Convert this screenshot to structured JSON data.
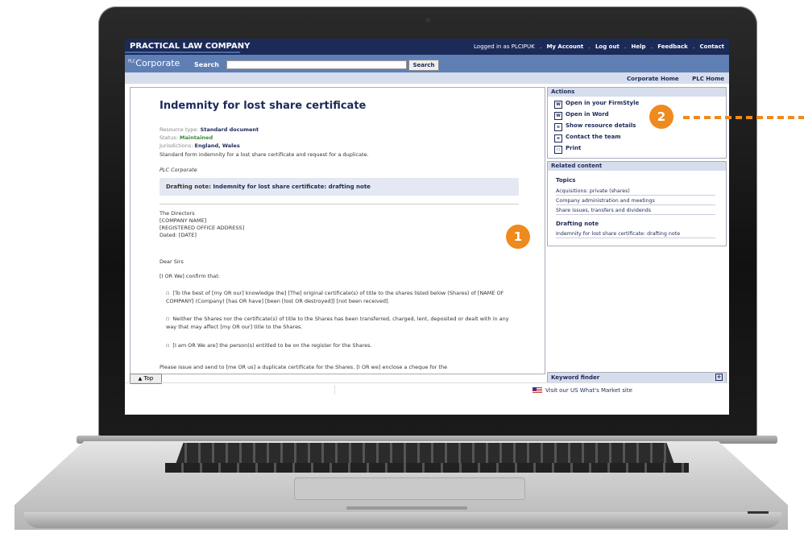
{
  "topbar": {
    "brand": "PRACTICAL LAW COMPANY",
    "logged_in": "Logged in as PLCIPUK",
    "links": [
      ".",
      "My Account",
      ".",
      "Log out",
      ".",
      "Help",
      ".",
      "Feedback",
      ".",
      "Contact"
    ]
  },
  "searchbar": {
    "section_prefix": "PLC",
    "section": "Corporate",
    "search_label": "Search",
    "search_value": "",
    "search_button": "Search"
  },
  "homebar": {
    "links": [
      "Corporate Home",
      "PLC Home"
    ]
  },
  "document": {
    "title": "Indemnity for lost share certificate",
    "resource_type_label": "Resource type:",
    "resource_type": "Standard document",
    "status_label": "Status:",
    "status": "Maintained",
    "jurisdictions_label": "Jurisdictions:",
    "jurisdictions": "England, Wales",
    "summary": "Standard form indemnity for a lost share certificate and request for a duplicate.",
    "source": "PLC Corporate",
    "drafting_label": "Drafting note:",
    "drafting_link": "Indemnity for lost share certificate: drafting note",
    "address": [
      "The Directors",
      "[COMPANY NAME]",
      "[REGISTERED OFFICE ADDRESS]",
      "Dated: [DATE]"
    ],
    "salutation": "Dear Sirs",
    "confirm": "[I OR We] confirm that:",
    "bullets": [
      "[To the best of [my OR our] knowledge the] [The] original certificate(s) of title to the shares listed below (Shares) of [NAME OF COMPANY] (Company) [has OR have] [been [lost OR destroyed]] [not been received].",
      "Neither the Shares nor the certificate(s) of title to the Shares has been transferred, charged, lent, deposited or dealt with in any way that may affect [my OR our] title to the Shares.",
      "[I am OR We are] the person(s) entitled to be on the register for the Shares."
    ],
    "closing": "Please issue and send to [me OR us] a duplicate certificate for the Shares. [I OR we] enclose a cheque for the"
  },
  "actions": {
    "title": "Actions",
    "items": [
      "Open in your FirmStyle",
      "Open in Word",
      "Show resource details",
      "Contact the team",
      "Print"
    ]
  },
  "related": {
    "title": "Related content",
    "topics_label": "Topics",
    "topics": [
      "Acquisitions: private (shares)",
      "Company administration and meetings",
      "Share issues, transfers and dividends"
    ],
    "drafting_label": "Drafting note",
    "drafting": [
      "Indemnity for lost share certificate: drafting note"
    ]
  },
  "footer": {
    "top_button": "Top",
    "keyword_finder": "Keyword finder",
    "us_link": "Visit our US What's Market site"
  },
  "callouts": [
    "1",
    "2"
  ],
  "colors": {
    "brand_navy": "#1c2a58",
    "accent_orange": "#ef8a1e",
    "status_green": "#3a8a3a"
  }
}
